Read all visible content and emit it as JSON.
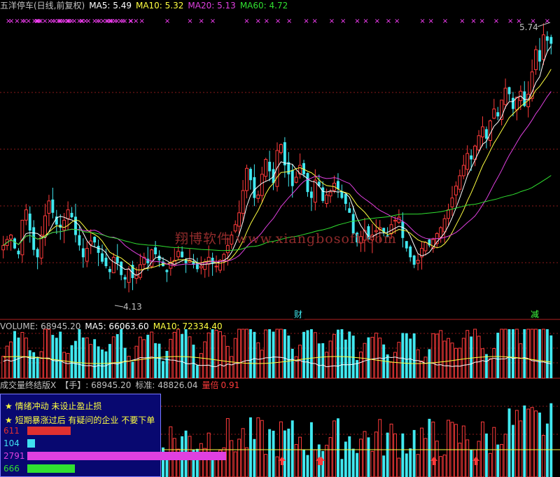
{
  "price_legend": {
    "title": "五洋停车(日线,前复权)",
    "ma5_label": "MA5: 5.49",
    "ma10_label": "MA10: 5.32",
    "ma20_label": "MA20: 5.13",
    "ma60_label": "MA60: 4.72"
  },
  "volume_legend": {
    "volume_label": "VOLUME: 68945.20",
    "ma5_label": "MA5: 66063.60",
    "ma10_label": "MA10: 72334.40"
  },
  "indicator_legend": {
    "name": "成交量终结版X",
    "unit_label": "【手】: 68945.20",
    "std_label": "标准: 48826.04",
    "ratio_name": "量倍",
    "ratio_value": "0.91"
  },
  "tips": {
    "line1": "★ 情绪冲动 未设止盈止损",
    "line2": "★ 短期暴涨过后 有疑问的企业 不要下单"
  },
  "stat_bars": [
    {
      "value": "611",
      "num": 611,
      "color": "#e03030"
    },
    {
      "value": "104",
      "num": 104,
      "color": "#40e0f0"
    },
    {
      "value": "2791",
      "num": 2791,
      "color": "#e040e0"
    },
    {
      "value": "666",
      "num": 666,
      "color": "#30e030"
    }
  ],
  "watermark": "翔博软件 www.xiangbosoft.com",
  "markers": {
    "cai": "财",
    "jian": "减",
    "cross": "×"
  },
  "colors": {
    "up": "#ff3b3b",
    "down": "#40e8f0",
    "ma5": "#ffffff",
    "ma10": "#ffff40",
    "ma20": "#e040e0",
    "ma60": "#30e030",
    "grid": "#8a1a1a",
    "marker": "#ff40ff",
    "std_line": "#ffff40",
    "ratio_red": "#ff3b3b"
  },
  "chart_data": [
    {
      "type": "candlestick",
      "title": "五洋停车(日线,前复权)",
      "ylim": [
        3.9,
        5.95
      ],
      "annotations": [
        {
          "text": "5.74",
          "label": "high"
        },
        {
          "text": "4.13",
          "label": "low"
        }
      ],
      "closes": [
        4.38,
        4.42,
        4.45,
        4.36,
        4.32,
        4.55,
        4.62,
        4.48,
        4.35,
        4.3,
        4.45,
        4.58,
        4.68,
        4.6,
        4.52,
        4.5,
        4.55,
        4.62,
        4.57,
        4.45,
        4.38,
        4.3,
        4.36,
        4.41,
        4.4,
        4.33,
        4.27,
        4.24,
        4.2,
        4.3,
        4.26,
        4.18,
        4.15,
        4.22,
        4.16,
        4.18,
        4.25,
        4.3,
        4.26,
        4.35,
        4.32,
        4.28,
        4.24,
        4.2,
        4.26,
        4.28,
        4.34,
        4.3,
        4.26,
        4.28,
        4.25,
        4.22,
        4.24,
        4.27,
        4.3,
        4.26,
        4.24,
        4.28,
        4.32,
        4.38,
        4.45,
        4.52,
        4.6,
        4.75,
        4.9,
        4.82,
        4.7,
        4.72,
        4.86,
        4.96,
        4.88,
        4.8,
        5.02,
        5.06,
        4.92,
        4.86,
        4.78,
        4.84,
        4.92,
        4.86,
        4.74,
        4.7,
        4.82,
        4.78,
        4.68,
        4.72,
        4.74,
        4.8,
        4.76,
        4.7,
        4.66,
        4.6,
        4.46,
        4.4,
        4.44,
        4.48,
        4.42,
        4.45,
        4.48,
        4.5,
        4.47,
        4.44,
        4.52,
        4.55,
        4.57,
        4.43,
        4.36,
        4.3,
        4.25,
        4.28,
        4.36,
        4.4,
        4.38,
        4.42,
        4.46,
        4.5,
        4.56,
        4.62,
        4.7,
        4.78,
        4.85,
        4.92,
        5.0,
        4.96,
        5.05,
        5.12,
        5.18,
        5.1,
        5.22,
        5.3,
        5.25,
        5.36,
        5.44,
        5.4,
        5.3,
        5.38,
        5.42,
        5.32,
        5.4,
        5.55,
        5.7,
        5.62,
        5.8,
        5.76,
        5.74
      ]
    },
    {
      "type": "bar",
      "title": "VOLUME",
      "series": [
        {
          "name": "VOLUME",
          "values": [
            68945.2
          ]
        },
        {
          "name": "MA5",
          "values": [
            66063.6
          ]
        },
        {
          "name": "MA10",
          "values": [
            72334.4
          ]
        }
      ]
    },
    {
      "type": "bar",
      "title": "成交量终结版X",
      "series": [
        {
          "name": "标准",
          "values": [
            48826.04
          ]
        },
        {
          "name": "量倍",
          "values": [
            0.91
          ]
        }
      ]
    }
  ]
}
